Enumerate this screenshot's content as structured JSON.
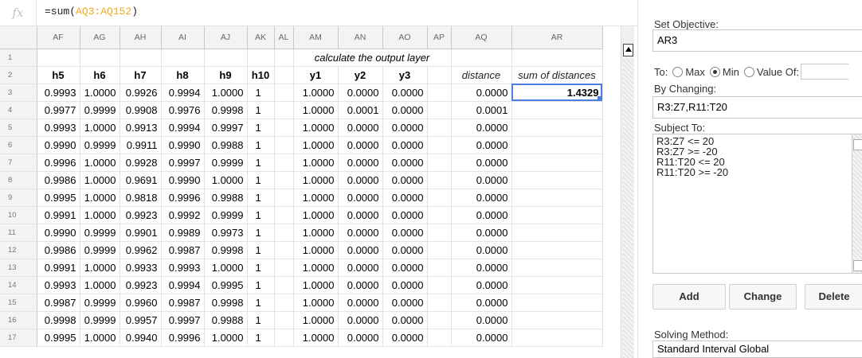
{
  "formula_bar": {
    "fx_symbol": "fx",
    "formula_prefix": "=sum(",
    "formula_ref": "AQ3:AQ152",
    "formula_suffix": ")"
  },
  "columns": [
    "AF",
    "AG",
    "AH",
    "AI",
    "AJ",
    "AK",
    "AL",
    "AM",
    "AN",
    "AO",
    "AP",
    "AQ",
    "AR"
  ],
  "row1": {
    "number": "1",
    "merged_note": "calculate the output layer"
  },
  "row2": {
    "number": "2",
    "cells": [
      "h5",
      "h6",
      "h7",
      "h8",
      "h9",
      "h10",
      "",
      "y1",
      "y2",
      "y3",
      "",
      "distance",
      "sum of distances"
    ]
  },
  "rows": [
    {
      "n": "3",
      "c": [
        "0.9993",
        "1.0000",
        "0.9926",
        "0.9994",
        "1.0000",
        "1",
        "",
        "1.0000",
        "0.0000",
        "0.0000",
        "",
        "0.0000",
        "1.4329"
      ]
    },
    {
      "n": "4",
      "c": [
        "0.9977",
        "0.9999",
        "0.9908",
        "0.9976",
        "0.9998",
        "1",
        "",
        "1.0000",
        "0.0001",
        "0.0000",
        "",
        "0.0001",
        ""
      ]
    },
    {
      "n": "5",
      "c": [
        "0.9993",
        "1.0000",
        "0.9913",
        "0.9994",
        "0.9997",
        "1",
        "",
        "1.0000",
        "0.0000",
        "0.0000",
        "",
        "0.0000",
        ""
      ]
    },
    {
      "n": "6",
      "c": [
        "0.9990",
        "0.9999",
        "0.9911",
        "0.9990",
        "0.9988",
        "1",
        "",
        "1.0000",
        "0.0000",
        "0.0000",
        "",
        "0.0000",
        ""
      ]
    },
    {
      "n": "7",
      "c": [
        "0.9996",
        "1.0000",
        "0.9928",
        "0.9997",
        "0.9999",
        "1",
        "",
        "1.0000",
        "0.0000",
        "0.0000",
        "",
        "0.0000",
        ""
      ]
    },
    {
      "n": "8",
      "c": [
        "0.9986",
        "1.0000",
        "0.9691",
        "0.9990",
        "1.0000",
        "1",
        "",
        "1.0000",
        "0.0000",
        "0.0000",
        "",
        "0.0000",
        ""
      ]
    },
    {
      "n": "9",
      "c": [
        "0.9995",
        "1.0000",
        "0.9818",
        "0.9996",
        "0.9988",
        "1",
        "",
        "1.0000",
        "0.0000",
        "0.0000",
        "",
        "0.0000",
        ""
      ]
    },
    {
      "n": "10",
      "c": [
        "0.9991",
        "1.0000",
        "0.9923",
        "0.9992",
        "0.9999",
        "1",
        "",
        "1.0000",
        "0.0000",
        "0.0000",
        "",
        "0.0000",
        ""
      ]
    },
    {
      "n": "11",
      "c": [
        "0.9990",
        "0.9999",
        "0.9901",
        "0.9989",
        "0.9973",
        "1",
        "",
        "1.0000",
        "0.0000",
        "0.0000",
        "",
        "0.0000",
        ""
      ]
    },
    {
      "n": "12",
      "c": [
        "0.9986",
        "0.9999",
        "0.9962",
        "0.9987",
        "0.9998",
        "1",
        "",
        "1.0000",
        "0.0000",
        "0.0000",
        "",
        "0.0000",
        ""
      ]
    },
    {
      "n": "13",
      "c": [
        "0.9991",
        "1.0000",
        "0.9933",
        "0.9993",
        "1.0000",
        "1",
        "",
        "1.0000",
        "0.0000",
        "0.0000",
        "",
        "0.0000",
        ""
      ]
    },
    {
      "n": "14",
      "c": [
        "0.9993",
        "1.0000",
        "0.9923",
        "0.9994",
        "0.9995",
        "1",
        "",
        "1.0000",
        "0.0000",
        "0.0000",
        "",
        "0.0000",
        ""
      ]
    },
    {
      "n": "15",
      "c": [
        "0.9987",
        "0.9999",
        "0.9960",
        "0.9987",
        "0.9998",
        "1",
        "",
        "1.0000",
        "0.0000",
        "0.0000",
        "",
        "0.0000",
        ""
      ]
    },
    {
      "n": "16",
      "c": [
        "0.9998",
        "0.9999",
        "0.9957",
        "0.9997",
        "0.9988",
        "1",
        "",
        "1.0000",
        "0.0000",
        "0.0000",
        "",
        "0.0000",
        ""
      ]
    },
    {
      "n": "17",
      "c": [
        "0.9995",
        "1.0000",
        "0.9940",
        "0.9996",
        "1.0000",
        "1",
        "",
        "1.0000",
        "0.0000",
        "0.0000",
        "",
        "0.0000",
        ""
      ]
    }
  ],
  "solver": {
    "set_objective_label": "Set Objective:",
    "objective_value": "AR3",
    "to_label": "To:",
    "opt_max": "Max",
    "opt_min": "Min",
    "opt_value_of": "Value Of:",
    "selected_option": "Min",
    "by_changing_label": "By Changing:",
    "by_changing_value": "R3:Z7,R11:T20",
    "subject_to_label": "Subject To:",
    "constraints": [
      "R3:Z7 <= 20",
      "R3:Z7 >= -20",
      "R11:T20 <= 20",
      "R11:T20 >= -20"
    ],
    "btn_add": "Add",
    "btn_change": "Change",
    "btn_delete": "Delete",
    "solving_method_label": "Solving Method:",
    "solving_method_value": "Standard Interval Global"
  }
}
